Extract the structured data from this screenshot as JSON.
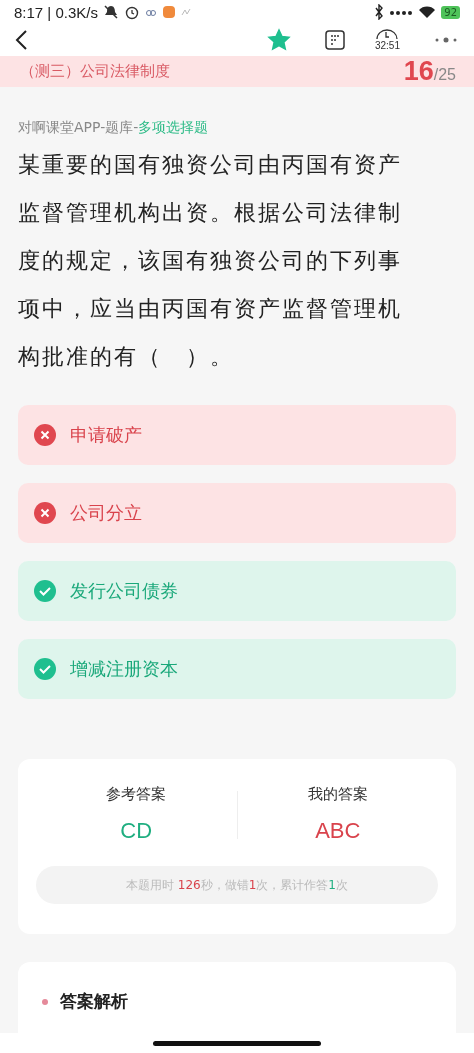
{
  "status_bar": {
    "time": "8:17 | 0.3K/s",
    "battery": "92"
  },
  "nav": {
    "favorited": true,
    "timer": "32:51"
  },
  "header": {
    "title": "（测三）公司法律制度",
    "current": "16",
    "total": "/25"
  },
  "question": {
    "source": "对啊课堂APP-题库-",
    "type": "多项选择题",
    "text": "某重要的国有独资公司由丙国有资产监督管理机构出资。根据公司法律制度的规定，该国有独资公司的下列事项中，应当由丙国有资产监督管理机构批准的有（　）。"
  },
  "options": [
    {
      "label": "申请破产",
      "kind": "wrong"
    },
    {
      "label": "公司分立",
      "kind": "wrong"
    },
    {
      "label": "发行公司债券",
      "kind": "correct"
    },
    {
      "label": "增减注册资本",
      "kind": "correct"
    }
  ],
  "answers": {
    "reference_label": "参考答案",
    "reference": "CD",
    "mine_label": "我的答案",
    "mine": "ABC",
    "stats": [
      {
        "text": "本题用时 ",
        "kind": "plain"
      },
      {
        "text": "126",
        "kind": "wrong"
      },
      {
        "text": "秒，做错",
        "kind": "plain"
      },
      {
        "text": "1",
        "kind": "wrong"
      },
      {
        "text": "次，累计作答",
        "kind": "plain"
      },
      {
        "text": "1",
        "kind": "correct"
      },
      {
        "text": "次",
        "kind": "plain"
      }
    ]
  },
  "analysis": {
    "title": "答案解析"
  }
}
